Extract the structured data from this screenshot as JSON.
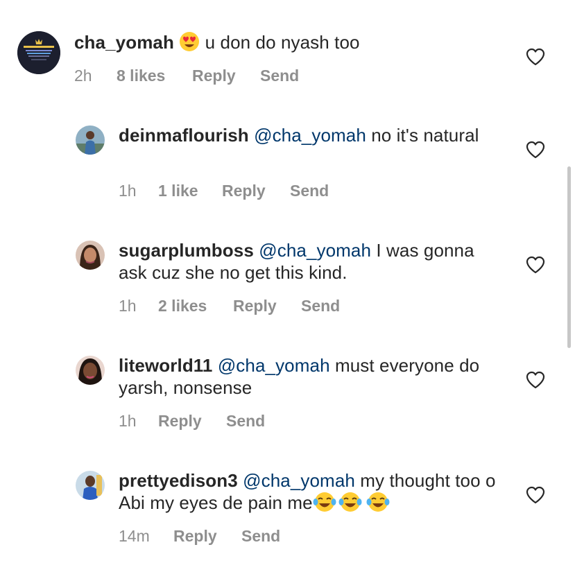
{
  "colors": {
    "text": "#262626",
    "mention": "#00376b",
    "meta": "#8e8e8e"
  },
  "comment": {
    "username": "cha_yomah",
    "emoji": "heart-eyes-emoji",
    "text": "u don do nyash too",
    "time": "2h",
    "likes": "8 likes",
    "reply_label": "Reply",
    "send_label": "Send",
    "avatar_icon": "avatar-cha-yomah"
  },
  "replies": [
    {
      "username": "deinmaflourish",
      "mention": "@cha_yomah",
      "text": "no it's natural",
      "time": "1h",
      "likes": "1 like",
      "reply_label": "Reply",
      "send_label": "Send"
    },
    {
      "username": "sugarplumboss",
      "mention": "@cha_yomah",
      "text": "I was gonna ask cuz she no get this kind.",
      "time": "1h",
      "likes": "2 likes",
      "reply_label": "Reply",
      "send_label": "Send"
    },
    {
      "username": "liteworld11",
      "mention": "@cha_yomah",
      "text": "must everyone do yarsh, nonsense",
      "time": "1h",
      "likes": "",
      "reply_label": "Reply",
      "send_label": "Send"
    },
    {
      "username": "prettyedison3",
      "mention": "@cha_yomah",
      "text": "my thought too o Abi my eyes de pain me",
      "emojis": [
        "tears-of-joy-emoji",
        "tears-of-joy-emoji",
        "tears-of-joy-emoji"
      ],
      "time": "14m",
      "likes": "",
      "reply_label": "Reply",
      "send_label": "Send"
    }
  ]
}
